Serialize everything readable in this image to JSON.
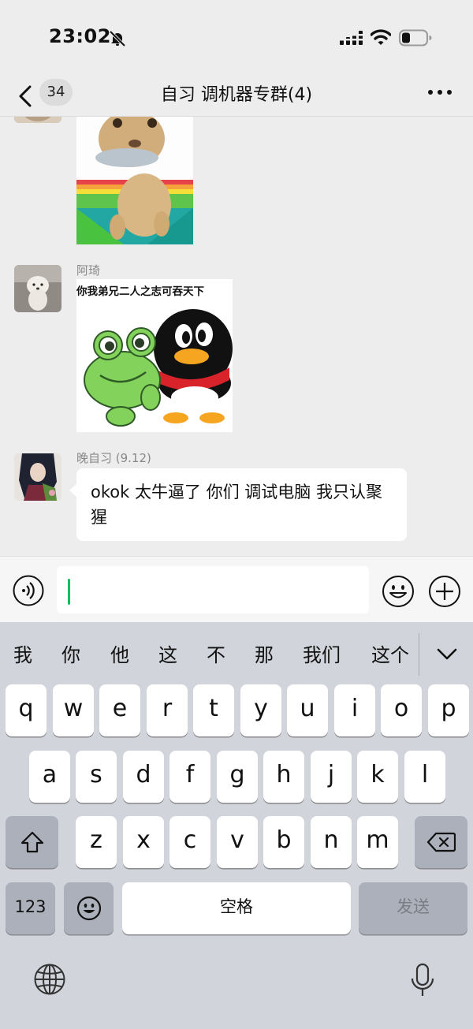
{
  "status_bar": {
    "time": "23:02"
  },
  "nav": {
    "unread_count": "34",
    "title": "自习 调机器专群(4)"
  },
  "messages": [
    {
      "type": "sticker"
    },
    {
      "type": "sticker",
      "sender": "阿琦",
      "sticker_caption": "你我弟兄二人之志可吞天下"
    },
    {
      "type": "text",
      "sender": "晚自习 (9.12)",
      "text": "okok 太牛逼了 你们 调试电脑 我只认聚猩"
    }
  ],
  "input": {
    "value": ""
  },
  "keyboard": {
    "candidates": [
      "我",
      "你",
      "他",
      "这",
      "不",
      "那",
      "我们",
      "这个"
    ],
    "row1": [
      "q",
      "w",
      "e",
      "r",
      "t",
      "y",
      "u",
      "i",
      "o",
      "p"
    ],
    "row2": [
      "a",
      "s",
      "d",
      "f",
      "g",
      "h",
      "j",
      "k",
      "l"
    ],
    "row3": [
      "z",
      "x",
      "c",
      "v",
      "b",
      "n",
      "m"
    ],
    "numbers_key": "123",
    "space_key": "空格",
    "send_key": "发送"
  },
  "icons": {
    "status": [
      "bell-off-icon",
      "cellular-signal-icon",
      "wifi-icon",
      "battery-icon"
    ],
    "nav": [
      "back-chevron-icon",
      "more-dots-icon"
    ],
    "input": [
      "voice-icon",
      "emoji-icon",
      "plus-icon"
    ],
    "keyboard": [
      "shift-icon",
      "backspace-icon",
      "emoji-key-icon",
      "globe-icon",
      "microphone-icon",
      "chevron-down-icon"
    ]
  },
  "colors": {
    "background": "#ededed",
    "accent_green": "#07c160",
    "bubble": "#ffffff",
    "keyboard_bg": "#d1d4da"
  }
}
